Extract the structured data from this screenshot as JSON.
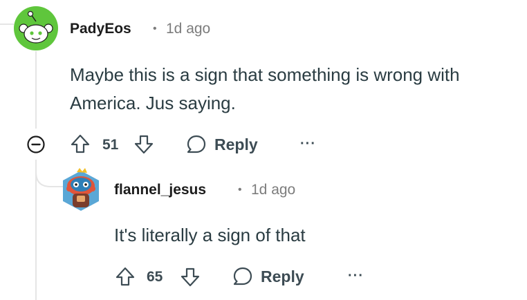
{
  "comments": [
    {
      "username": "PadyEos",
      "separator": "•",
      "time": "1d ago",
      "body": "Maybe this is a sign that something is wrong with America. Jus saying.",
      "votes": "51",
      "reply_label": "Reply",
      "more_label": "···"
    },
    {
      "username": "flannel_jesus",
      "separator": "•",
      "time": "1d ago",
      "body": "It's literally a sign of that",
      "votes": "65",
      "reply_label": "Reply",
      "more_label": "···"
    }
  ],
  "colors": {
    "avatar_green": "#5fc63c",
    "text": "#2a3c42",
    "muted": "#7c7c7c",
    "icon": "#3d4c54",
    "thread_line": "#e5e5e5"
  },
  "icons": [
    "reddit-snoo-avatar",
    "collapse-icon",
    "upvote-icon",
    "downvote-icon",
    "reply-bubble-icon",
    "more-icon"
  ]
}
